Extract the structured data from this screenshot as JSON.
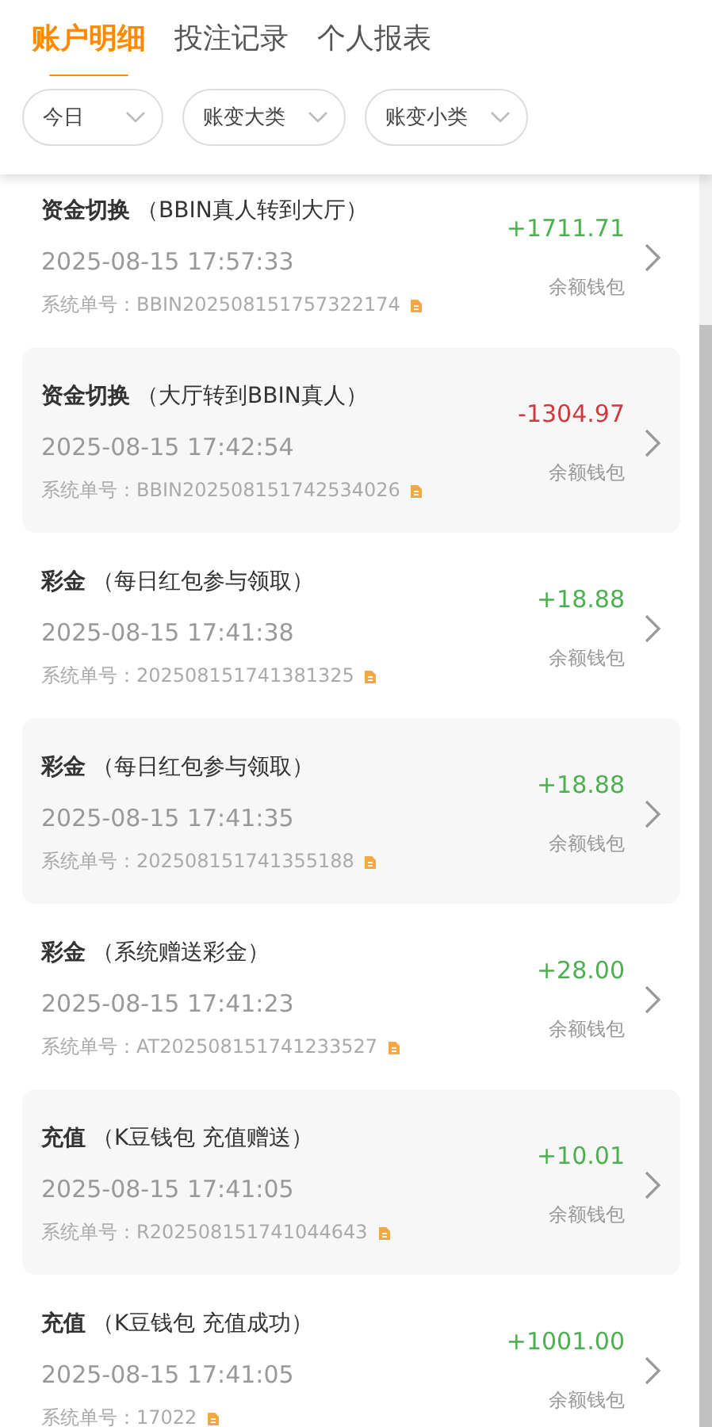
{
  "tabs": [
    {
      "label": "账户明细",
      "selected": true
    },
    {
      "label": "投注记录",
      "selected": false
    },
    {
      "label": "个人报表",
      "selected": false
    }
  ],
  "filters": [
    {
      "label": "今日"
    },
    {
      "label": "账变大类"
    },
    {
      "label": "账变小类"
    }
  ],
  "records": [
    {
      "title": "资金切换",
      "note": "（BBIN真人转到大厅）",
      "time": "2025-08-15 17:57:33",
      "order": "系统单号：BBIN202508151757322174",
      "amount": "+1711.71",
      "color": "#4caf50",
      "wallet": "余额钱包"
    },
    {
      "title": "资金切换",
      "note": "（大厅转到BBIN真人）",
      "time": "2025-08-15 17:42:54",
      "order": "系统单号：BBIN202508151742534026",
      "amount": "-1304.97",
      "color": "#d0393e",
      "wallet": "余额钱包"
    },
    {
      "title": "彩金",
      "note": "（每日红包参与领取）",
      "time": "2025-08-15 17:41:38",
      "order": "系统单号：202508151741381325",
      "amount": "+18.88",
      "color": "#4caf50",
      "wallet": "余额钱包"
    },
    {
      "title": "彩金",
      "note": "（每日红包参与领取）",
      "time": "2025-08-15 17:41:35",
      "order": "系统单号：202508151741355188",
      "amount": "+18.88",
      "color": "#4caf50",
      "wallet": "余额钱包"
    },
    {
      "title": "彩金",
      "note": "（系统赠送彩金）",
      "time": "2025-08-15 17:41:23",
      "order": "系统单号：AT202508151741233527",
      "amount": "+28.00",
      "color": "#4caf50",
      "wallet": "余额钱包"
    },
    {
      "title": "充值",
      "note": "（K豆钱包 充值赠送）",
      "time": "2025-08-15 17:41:05",
      "order": "系统单号：R202508151741044643",
      "amount": "+10.01",
      "color": "#4caf50",
      "wallet": "余额钱包"
    },
    {
      "title": "充值",
      "note": "（K豆钱包 充值成功）",
      "time": "2025-08-15 17:41:05",
      "order": "系统单号：17022",
      "amount": "+1001.00",
      "color": "#4caf50",
      "wallet": "余额钱包"
    }
  ]
}
